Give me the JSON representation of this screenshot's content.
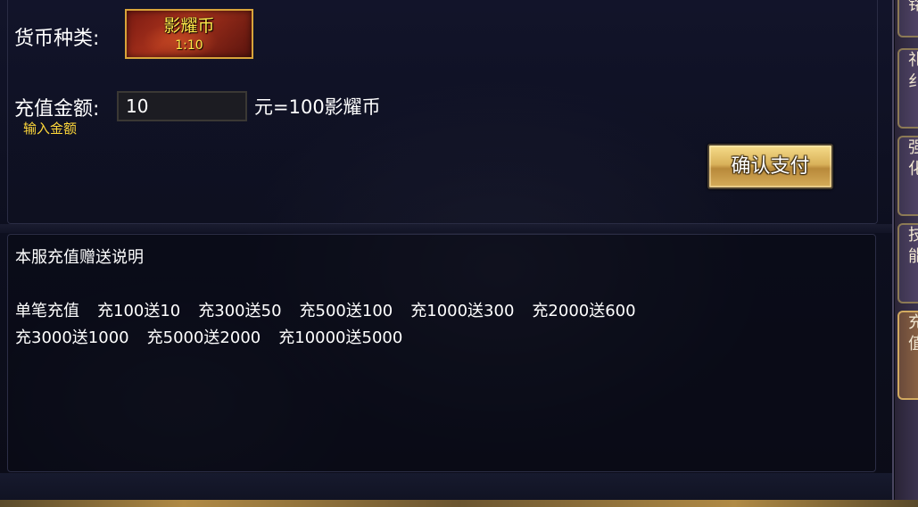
{
  "recharge": {
    "currency_label": "货币种类:",
    "currency_name": "影耀币",
    "currency_ratio": "1:10",
    "amount_label": "充值金额:",
    "amount_value": "10",
    "amount_hint": "输入金额",
    "rate_text": "元=100影耀币",
    "confirm_label": "确认支付"
  },
  "notes": {
    "title": "本服充值赠送说明",
    "line1": [
      "单笔充值",
      "充100送10",
      "充300送50",
      "充500送100",
      "充1000送300",
      "充2000送600"
    ],
    "line2": [
      "充3000送1000",
      "充5000送2000",
      "充10000送5000"
    ]
  },
  "side_tabs": [
    {
      "label": "铭"
    },
    {
      "label": "礼纟"
    },
    {
      "label": "强化"
    },
    {
      "label": "技能"
    },
    {
      "label": "充值"
    }
  ],
  "colors": {
    "accent_gold": "#d8a43a",
    "hint_yellow": "#ffd83a",
    "currency_text": "#ffe84a"
  }
}
